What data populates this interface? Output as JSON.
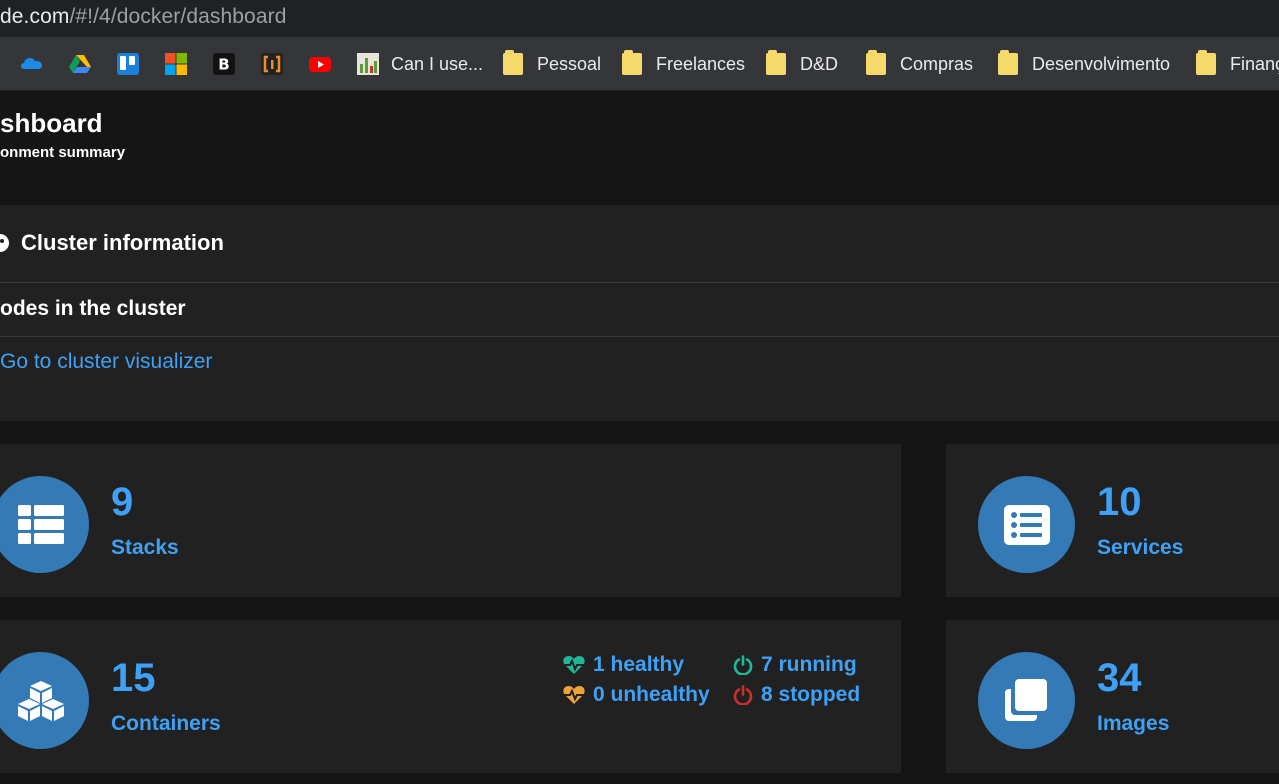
{
  "address_bar": {
    "host": "de.com",
    "path": "/#!/4/docker/dashboard"
  },
  "bookmarks": [
    {
      "icon": "onedrive-icon",
      "label": ""
    },
    {
      "icon": "google-drive-icon",
      "label": ""
    },
    {
      "icon": "trello-icon",
      "label": ""
    },
    {
      "icon": "microsoft-icon",
      "label": ""
    },
    {
      "icon": "b-app-icon",
      "label": ""
    },
    {
      "icon": "bracket-app-icon",
      "label": ""
    },
    {
      "icon": "youtube-icon",
      "label": ""
    },
    {
      "icon": "caniuse-icon",
      "label": "Can I use..."
    },
    {
      "icon": "folder-icon",
      "label": "Pessoal"
    },
    {
      "icon": "folder-icon",
      "label": "Freelances"
    },
    {
      "icon": "folder-icon",
      "label": "D&D"
    },
    {
      "icon": "folder-icon",
      "label": "Compras"
    },
    {
      "icon": "folder-icon",
      "label": "Desenvolvimento"
    },
    {
      "icon": "folder-icon",
      "label": "Finanç"
    }
  ],
  "page": {
    "title": "shboard",
    "subtitle": "onment summary"
  },
  "cluster": {
    "title": "Cluster information",
    "nodes_text": "odes in the cluster",
    "visualizer_link": "Go to cluster visualizer"
  },
  "cards": {
    "stacks": {
      "count": "9",
      "label": "Stacks",
      "icon": "stack-table-icon"
    },
    "services": {
      "count": "10",
      "label": "Services",
      "icon": "list-icon"
    },
    "containers": {
      "count": "15",
      "label": "Containers",
      "icon": "cubes-icon"
    },
    "images": {
      "count": "34",
      "label": "Images",
      "icon": "copy-icon"
    }
  },
  "container_status": {
    "healthy": "1 healthy",
    "unhealthy": "0 unhealthy",
    "running": "7 running",
    "stopped": "8 stopped"
  },
  "colors": {
    "accent": "#3fa1f5",
    "circle": "#337ab7",
    "healthy_icon": "#20b799",
    "unhealthy_icon": "#f0a23b",
    "running": "#20b799",
    "stopped": "#c9302c"
  }
}
